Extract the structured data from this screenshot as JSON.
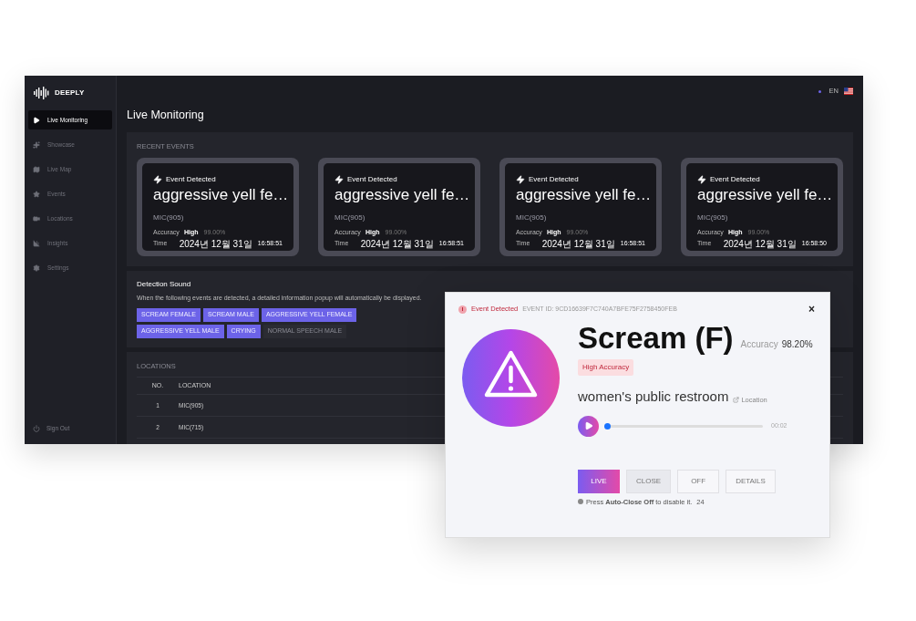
{
  "brand": "DEEPLY",
  "topbar": {
    "language": "EN"
  },
  "sidebar": {
    "items": [
      {
        "label": "Live Monitoring",
        "selected": true
      },
      {
        "label": "Showcase",
        "selected": false
      },
      {
        "label": "Live Map",
        "selected": false
      },
      {
        "label": "Events",
        "selected": false
      },
      {
        "label": "Locations",
        "selected": false
      },
      {
        "label": "Insights",
        "selected": false
      },
      {
        "label": "Settings",
        "selected": false
      }
    ],
    "sign_out": "Sign Out"
  },
  "page_title": "Live Monitoring",
  "recent_events": {
    "heading": "RECENT EVENTS",
    "cards": [
      {
        "badge": "Event Detected",
        "title": "aggressive yell fe…",
        "mic": "MIC(905)",
        "accuracy_label": "Accuracy",
        "accuracy_level": "High",
        "accuracy_value": "99.00%",
        "time_label": "Time",
        "date": "2024년 12월 31일",
        "time": "16:58:51"
      },
      {
        "badge": "Event Detected",
        "title": "aggressive yell fe…",
        "mic": "MIC(905)",
        "accuracy_label": "Accuracy",
        "accuracy_level": "High",
        "accuracy_value": "99.00%",
        "time_label": "Time",
        "date": "2024년 12월 31일",
        "time": "16:58:51"
      },
      {
        "badge": "Event Detected",
        "title": "aggressive yell fe…",
        "mic": "MIC(905)",
        "accuracy_label": "Accuracy",
        "accuracy_level": "High",
        "accuracy_value": "99.00%",
        "time_label": "Time",
        "date": "2024년 12월 31일",
        "time": "16:58:51"
      },
      {
        "badge": "Event Detected",
        "title": "aggressive yell fe…",
        "mic": "MIC(905)",
        "accuracy_label": "Accuracy",
        "accuracy_level": "High",
        "accuracy_value": "99.00%",
        "time_label": "Time",
        "date": "2024년 12월 31일",
        "time": "16:58:50"
      }
    ]
  },
  "detection_sound": {
    "heading": "Detection Sound",
    "description": "When the following events are detected, a detailed information popup will automatically be displayed.",
    "chips": [
      {
        "label": "SCREAM FEMALE",
        "selected": true
      },
      {
        "label": "SCREAM MALE",
        "selected": true
      },
      {
        "label": "AGGRESSIVE YELL FEMALE",
        "selected": true
      },
      {
        "label": "AGGRESSIVE YELL MALE",
        "selected": true
      },
      {
        "label": "CRYING",
        "selected": true
      },
      {
        "label": "NORMAL SPEECH MALE",
        "selected": false
      }
    ]
  },
  "locations": {
    "heading": "LOCATIONS",
    "columns": [
      "NO.",
      "LOCATION"
    ],
    "rows": [
      [
        "1",
        "MIC(905)"
      ],
      [
        "2",
        "MIC(715)"
      ]
    ]
  },
  "popup": {
    "badge": "Event Detected",
    "event_id": "EVENT ID: 9CD16639F7C740A7BFE75F2758450FEB",
    "close": "×",
    "title": "Scream (F)",
    "accuracy_label": "Accuracy",
    "accuracy_value": "98.20%",
    "accuracy_tag": "High Accuracy",
    "location": "women's public restroom",
    "location_link": "Location",
    "player": {
      "level": 0,
      "time": "00:02"
    },
    "buttons": [
      {
        "label": "LIVE",
        "selected": true
      },
      {
        "label": "CLOSE",
        "selected": false
      },
      {
        "label": "OFF",
        "selected": false
      },
      {
        "label": "DETAILS",
        "selected": false
      }
    ],
    "hint": "Press **Auto-Close Off** to disable it.",
    "countdown": "24"
  }
}
